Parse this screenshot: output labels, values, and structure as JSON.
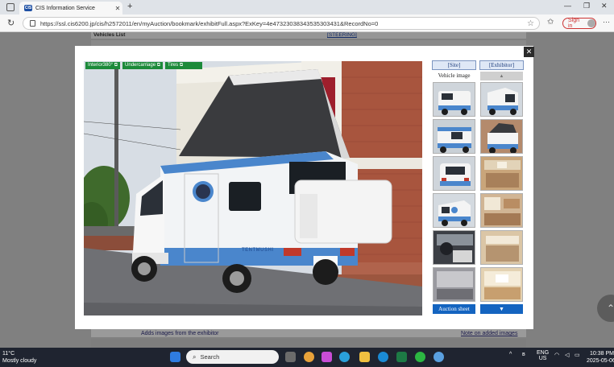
{
  "browser": {
    "tab_title": "CIS Information Service",
    "favicon_text": "CIS",
    "new_tab": "+",
    "url": "https://ssl.cis6200.jp/cis/h2572011/en/myAuction/bookmark/exhibitFull.aspx?ExKey=4e47323038343535303431&RecordNo=0",
    "signin_label": "Sign in"
  },
  "background_page": {
    "vehicles_list": "Vehicles List",
    "steering": "STEERING",
    "added_images": "Adds images from the exhibitor",
    "note_link": "Note on added images"
  },
  "modal": {
    "close_label": "✕",
    "photo_tags": [
      "Interior380°",
      "Undercarriage",
      "Tires"
    ],
    "side_tabs": [
      "[Site]",
      "[Exhibitor]"
    ],
    "vehicle_image_label": "Vehicle image",
    "up_arrow": "▲",
    "down_arrow": "▼",
    "auction_sheet_label": "Auction sheet",
    "van_badge": "TENTMUSHI"
  },
  "taskbar": {
    "temp": "11°C",
    "weather": "Mostly cloudy",
    "search_placeholder": "Search",
    "lang": "ENG",
    "region": "US",
    "time": "10:38 PM",
    "date": "2025-05-06"
  }
}
